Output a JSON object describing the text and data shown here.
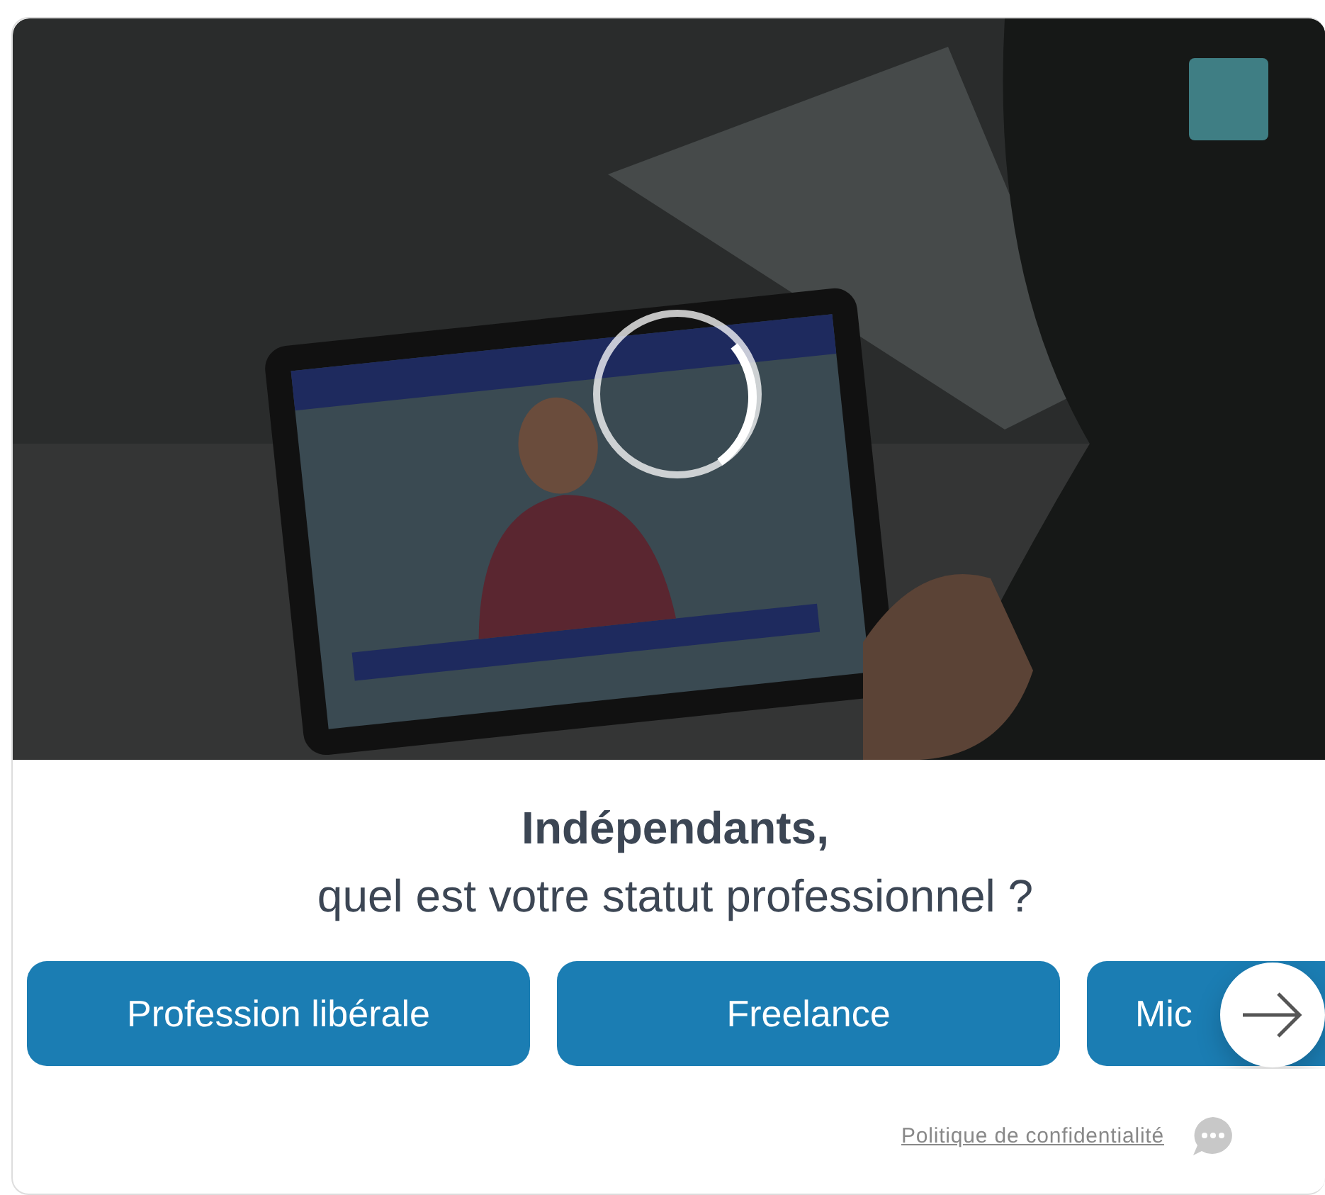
{
  "video": {
    "kind": "picture",
    "loading": true
  },
  "heading": {
    "title": "Indépendants,",
    "subtitle": "quel est votre statut professionnel ?"
  },
  "options": [
    {
      "label": "Profession libérale"
    },
    {
      "label": "Freelance"
    },
    {
      "label": "Mic"
    }
  ],
  "footer": {
    "privacy_link": "Politique de confidentialité"
  }
}
